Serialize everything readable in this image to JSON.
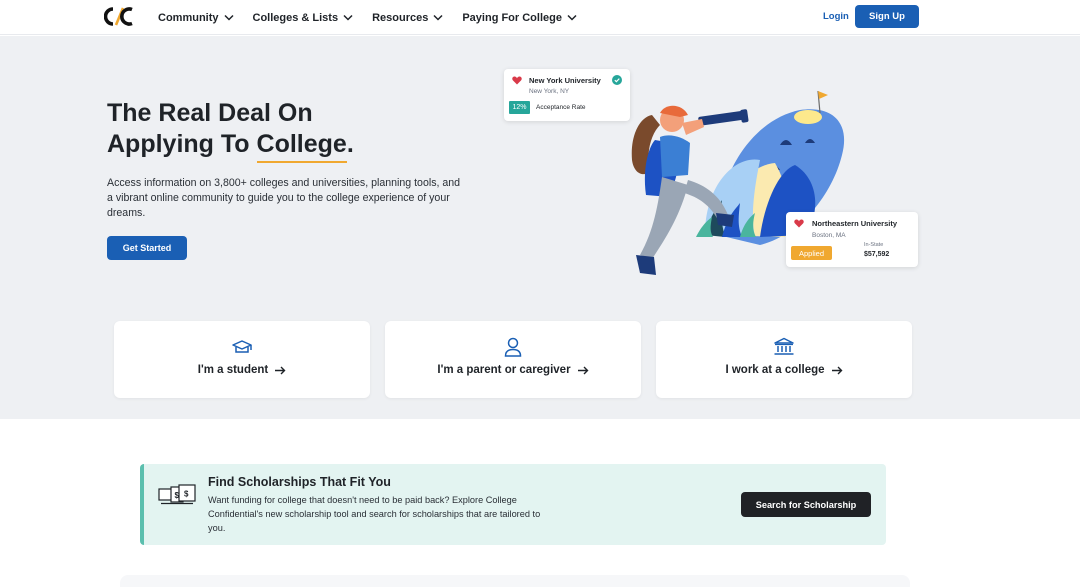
{
  "nav": {
    "logo": "C/C",
    "items": [
      {
        "label": "Community"
      },
      {
        "label": "Colleges & Lists"
      },
      {
        "label": "Resources"
      },
      {
        "label": "Paying For College"
      }
    ],
    "login": "Login",
    "signup": "Sign Up"
  },
  "hero": {
    "title_line1": "The Real Deal On",
    "title_line2_pre": "Applying To ",
    "title_line2_underlined": "College",
    "title_line2_post": ".",
    "description": "Access information on 3,800+ colleges and universities, planning tools, and a vibrant online community to guide you to the college experience of your dreams.",
    "cta": "Get Started"
  },
  "cards": {
    "ny": {
      "name": "New York University",
      "location": "New York, NY",
      "rate": "12%",
      "rate_label": "Acceptance Rate"
    },
    "ne": {
      "name": "Northeastern University",
      "location": "Boston, MA",
      "status": "Applied",
      "tuition_label": "In-State",
      "tuition": "$57,592"
    }
  },
  "personas": [
    {
      "label": "I'm a student",
      "icon": "graduation-cap-icon"
    },
    {
      "label": "I'm a parent or caregiver",
      "icon": "person-icon"
    },
    {
      "label": "I work at a college",
      "icon": "institution-icon"
    }
  ],
  "scholarship": {
    "title": "Find Scholarships That Fit You",
    "description": "Want funding for college that doesn't need to be paid back? Explore College Confidential's new scholarship tool and search for scholarships that are tailored to you.",
    "button": "Search for Scholarship"
  },
  "colors": {
    "primary": "#1a5fb4",
    "accent": "#f0a830",
    "teal": "#26a69a",
    "hero_bg": "#eef0f3"
  }
}
